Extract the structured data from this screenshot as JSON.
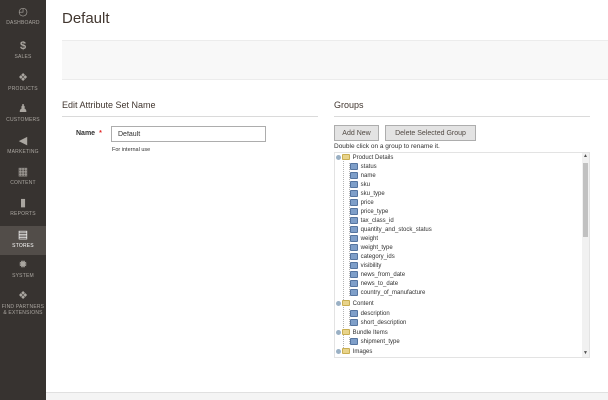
{
  "sidebar": {
    "items": [
      {
        "label": "DASHBOARD",
        "icon": "dashboard-icon",
        "glyph": "◴"
      },
      {
        "label": "SALES",
        "icon": "dollar-icon",
        "glyph": "$"
      },
      {
        "label": "PRODUCTS",
        "icon": "cube-icon",
        "glyph": "❖"
      },
      {
        "label": "CUSTOMERS",
        "icon": "person-icon",
        "glyph": "♟"
      },
      {
        "label": "MARKETING",
        "icon": "megaphone-icon",
        "glyph": "◀"
      },
      {
        "label": "CONTENT",
        "icon": "layout-icon",
        "glyph": "▦"
      },
      {
        "label": "REPORTS",
        "icon": "bar-chart-icon",
        "glyph": "▮"
      },
      {
        "label": "STORES",
        "icon": "store-icon",
        "glyph": "▤"
      },
      {
        "label": "SYSTEM",
        "icon": "gear-icon",
        "glyph": "✹"
      },
      {
        "label": "FIND PARTNERS",
        "label2": "& EXTENSIONS",
        "icon": "partners-icon",
        "glyph": "❖"
      }
    ],
    "active": "STORES"
  },
  "page": {
    "title": "Default"
  },
  "attribute_set": {
    "section_title": "Edit Attribute Set Name",
    "name_label": "Name",
    "required_mark": "*",
    "name_value": "Default",
    "name_note": "For internal use"
  },
  "groups": {
    "section_title": "Groups",
    "add_button": "Add New",
    "delete_button": "Delete Selected Group",
    "hint": "Double click on a group to rename it.",
    "tree": [
      {
        "label": "Product Details",
        "type": "group"
      },
      {
        "label": "status",
        "type": "attr"
      },
      {
        "label": "name",
        "type": "attr"
      },
      {
        "label": "sku",
        "type": "attr"
      },
      {
        "label": "sku_type",
        "type": "attr"
      },
      {
        "label": "price",
        "type": "attr"
      },
      {
        "label": "price_type",
        "type": "attr"
      },
      {
        "label": "tax_class_id",
        "type": "attr"
      },
      {
        "label": "quantity_and_stock_status",
        "type": "attr"
      },
      {
        "label": "weight",
        "type": "attr"
      },
      {
        "label": "weight_type",
        "type": "attr"
      },
      {
        "label": "category_ids",
        "type": "attr"
      },
      {
        "label": "visibility",
        "type": "attr"
      },
      {
        "label": "news_from_date",
        "type": "attr"
      },
      {
        "label": "news_to_date",
        "type": "attr"
      },
      {
        "label": "country_of_manufacture",
        "type": "attr"
      },
      {
        "label": "Content",
        "type": "group"
      },
      {
        "label": "description",
        "type": "attr"
      },
      {
        "label": "short_description",
        "type": "attr"
      },
      {
        "label": "Bundle Items",
        "type": "group"
      },
      {
        "label": "shipment_type",
        "type": "attr"
      },
      {
        "label": "Images",
        "type": "group"
      }
    ]
  },
  "scrollbar": {
    "up": "▲",
    "down": "▼"
  }
}
